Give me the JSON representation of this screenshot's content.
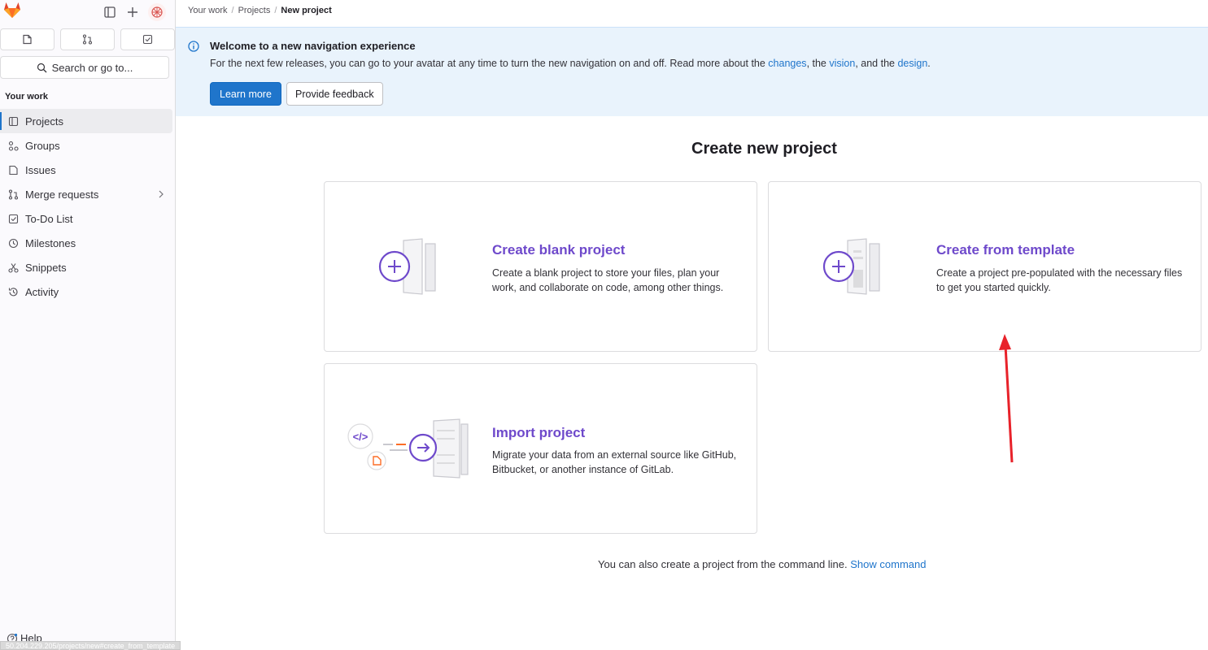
{
  "sidebar": {
    "search_label": "Search or go to...",
    "section_title": "Your work",
    "items": [
      {
        "label": "Projects",
        "icon": "project-icon"
      },
      {
        "label": "Groups",
        "icon": "group-icon"
      },
      {
        "label": "Issues",
        "icon": "issues-icon"
      },
      {
        "label": "Merge requests",
        "icon": "merge-request-icon"
      },
      {
        "label": "To-Do List",
        "icon": "todo-icon"
      },
      {
        "label": "Milestones",
        "icon": "milestone-icon"
      },
      {
        "label": "Snippets",
        "icon": "snippet-icon"
      },
      {
        "label": "Activity",
        "icon": "history-icon"
      }
    ],
    "help_label": "Help",
    "status_url": "50.204.229.205/projects/new#create_from_template"
  },
  "breadcrumb": [
    "Your work",
    "Projects",
    "New project"
  ],
  "banner": {
    "title": "Welcome to a new navigation experience",
    "text_before": "For the next few releases, you can go to your avatar at any time to turn the new navigation on and off. Read more about the ",
    "link_changes": "changes",
    "text_mid1": ", the ",
    "link_vision": "vision",
    "text_mid2": ", and the ",
    "link_design": "design",
    "text_end": ".",
    "learn_more": "Learn more",
    "feedback": "Provide feedback"
  },
  "page_title": "Create new project",
  "cards": {
    "blank": {
      "title": "Create blank project",
      "desc": "Create a blank project to store your files, plan your work, and collaborate on code, among other things."
    },
    "template": {
      "title": "Create from template",
      "desc": "Create a project pre-populated with the necessary files to get you started quickly."
    },
    "import": {
      "title": "Import project",
      "desc": "Migrate your data from an external source like GitHub, Bitbucket, or another instance of GitLab."
    }
  },
  "cli": {
    "text": "You can also create a project from the command line.",
    "link": "Show command"
  },
  "colors": {
    "accent": "#1f75cb",
    "purple": "#6e49cb",
    "annotation": "#e8222a"
  }
}
